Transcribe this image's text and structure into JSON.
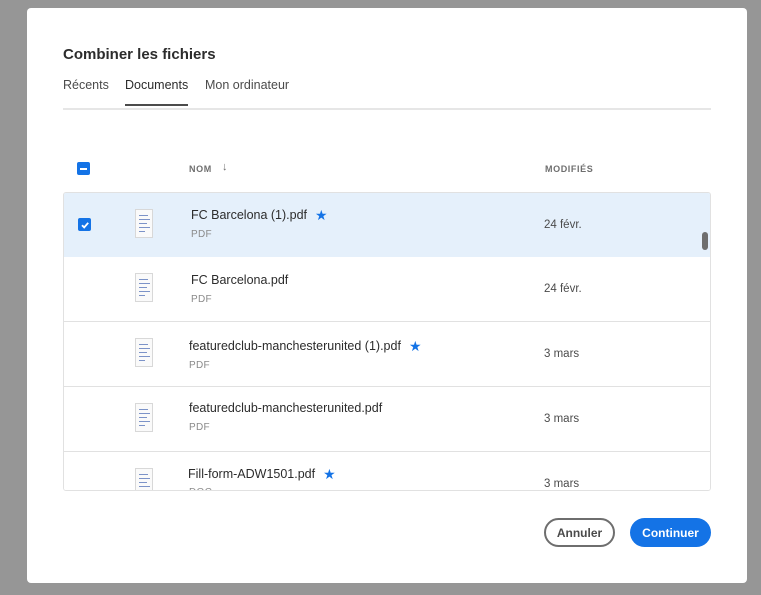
{
  "dialog": {
    "title": "Combiner les fichiers",
    "tabs": [
      {
        "label": "Récents",
        "active": false
      },
      {
        "label": "Documents",
        "active": true
      },
      {
        "label": "Mon ordinateur",
        "active": false
      }
    ]
  },
  "table": {
    "columns": {
      "name": "NOM",
      "modified": "MODIFIÉS"
    },
    "sort_icon": "arrow-down-icon",
    "header_checkbox": "indeterminate",
    "rows": [
      {
        "name": "FC Barcelona (1).pdf",
        "type": "PDF",
        "modified": "24 févr.",
        "starred": true,
        "selected": true
      },
      {
        "name": "FC Barcelona.pdf",
        "type": "PDF",
        "modified": "24 févr.",
        "starred": false,
        "selected": false
      },
      {
        "name": "featuredclub-manchesterunited (1).pdf",
        "type": "PDF",
        "modified": "3 mars",
        "starred": true,
        "selected": false
      },
      {
        "name": "featuredclub-manchesterunited.pdf",
        "type": "PDF",
        "modified": "3 mars",
        "starred": false,
        "selected": false
      },
      {
        "name": "Fill-form-ADW1501.pdf",
        "type": "DOC",
        "modified": "3 mars",
        "starred": true,
        "selected": false
      }
    ]
  },
  "buttons": {
    "cancel": "Annuler",
    "continue": "Continuer"
  },
  "colors": {
    "accent": "#1473e6",
    "selected_row": "#e5f0fb",
    "overlay": "#969696"
  }
}
